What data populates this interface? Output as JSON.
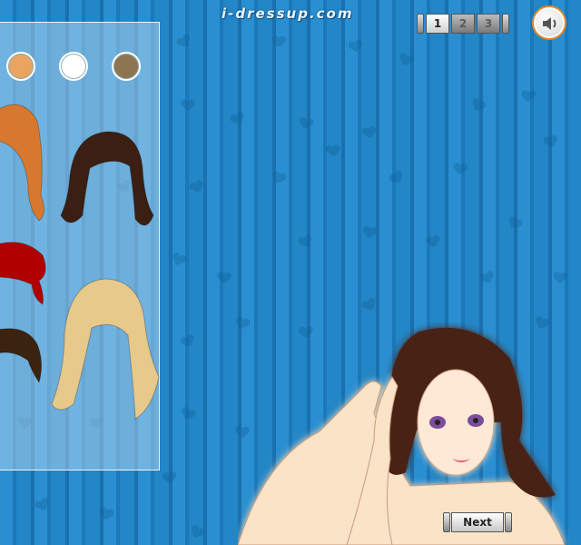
{
  "site_logo": "i-dressup.com",
  "pager": {
    "pages": [
      "1",
      "2",
      "3"
    ],
    "active": 1
  },
  "sound_icon": "speaker-icon",
  "hair_panel": {
    "swatches": [
      "#e9a461",
      "#ffffff",
      "#8e7552"
    ],
    "styles": [
      {
        "name": "long-straight-auburn-hair",
        "color": "#d8782f"
      },
      {
        "name": "wavy-dark-brown-hair",
        "color": "#3a1f12"
      },
      {
        "name": "red-updo-hair",
        "color": "#b00000"
      },
      {
        "name": "long-wavy-blonde-hair",
        "color": "#e6c98b"
      },
      {
        "name": "dark-brown-short-hair",
        "color": "#3a230f"
      }
    ]
  },
  "next_button": {
    "label": "Next"
  },
  "colors": {
    "background": "#2386c6",
    "accent": "#e28a2b"
  }
}
